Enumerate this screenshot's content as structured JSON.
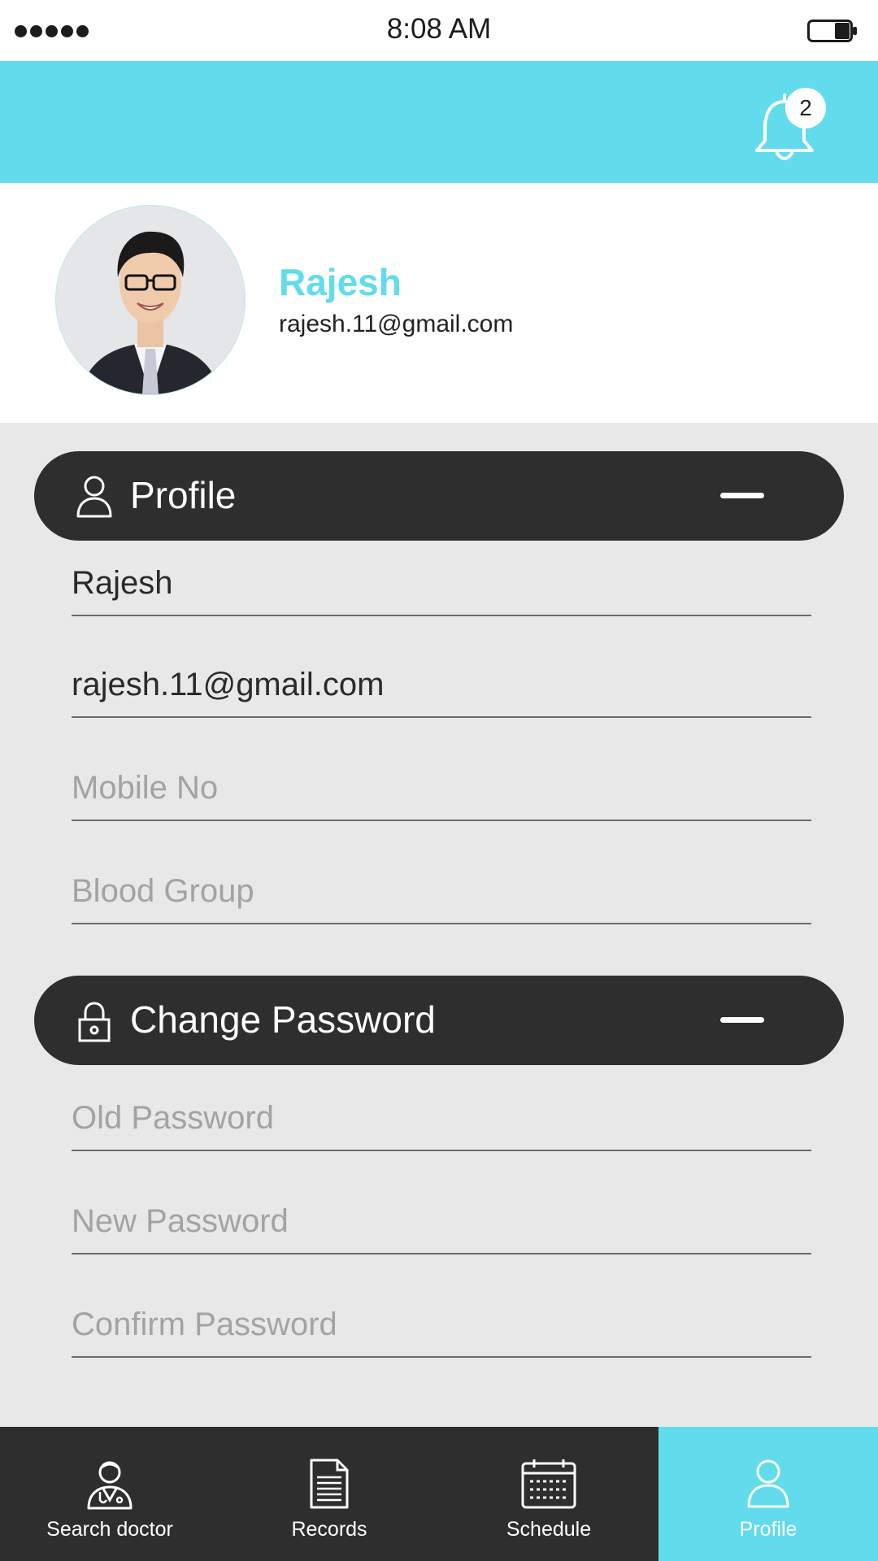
{
  "status_bar": {
    "time": "8:08 AM"
  },
  "header": {
    "notification_count": "2"
  },
  "user": {
    "name": "Rajesh",
    "email": "rajesh.11@gmail.com"
  },
  "profile_section": {
    "title": "Profile",
    "fields": {
      "name": {
        "value": "Rajesh",
        "placeholder": ""
      },
      "email": {
        "value": "rajesh.11@gmail.com",
        "placeholder": ""
      },
      "mobile": {
        "value": "",
        "placeholder": "Mobile No"
      },
      "blood_group": {
        "value": "",
        "placeholder": "Blood Group"
      }
    }
  },
  "password_section": {
    "title": "Change Password",
    "fields": {
      "old": {
        "placeholder": "Old Password"
      },
      "new": {
        "placeholder": "New Password"
      },
      "confirm": {
        "placeholder": "Confirm Password"
      }
    }
  },
  "bottom_nav": {
    "items": [
      {
        "label": "Search doctor",
        "icon": "doctor-icon"
      },
      {
        "label": "Records",
        "icon": "document-icon"
      },
      {
        "label": "Schedule",
        "icon": "calendar-icon"
      },
      {
        "label": "Profile",
        "icon": "user-icon",
        "active": true
      }
    ]
  },
  "colors": {
    "accent": "#62dcec",
    "dark": "#2e2e2e",
    "content_bg": "#e8e8e8"
  }
}
